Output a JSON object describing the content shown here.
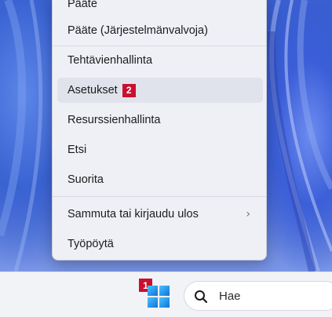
{
  "context_menu": {
    "items": [
      {
        "label": "Pääte"
      },
      {
        "label": "Pääte (Järjestelmänvalvoja)"
      },
      {
        "label": "Tehtävienhallinta"
      },
      {
        "label": "Asetukset",
        "badge": "2"
      },
      {
        "label": "Resurssienhallinta"
      },
      {
        "label": "Etsi"
      },
      {
        "label": "Suorita"
      },
      {
        "label": "Sammuta tai kirjaudu ulos",
        "has_submenu": true
      },
      {
        "label": "Työpöytä"
      }
    ]
  },
  "taskbar": {
    "start_badge": "1",
    "search_placeholder": "Hae"
  },
  "colors": {
    "badge": "#c8102e",
    "menu_bg": "#eef0f6",
    "taskbar_bg": "#f2f3f7",
    "start_blue": "#0a74da"
  }
}
